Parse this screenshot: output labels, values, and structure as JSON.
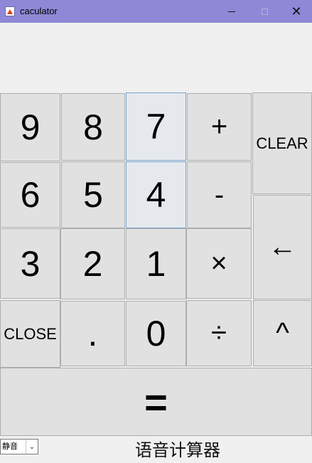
{
  "window": {
    "title": "caculator",
    "minimize_icon": "minimize-icon",
    "maximize_icon": "maximize-icon",
    "close_icon": "close-icon",
    "close_glyph": "✕"
  },
  "display": {
    "value": ""
  },
  "keys": {
    "k9": "9",
    "k8": "8",
    "k7": "7",
    "plus": "+",
    "clear": "CLEAR",
    "k6": "6",
    "k5": "5",
    "k4": "4",
    "minus": "-",
    "k3": "3",
    "k2": "2",
    "k1": "1",
    "multiply": "×",
    "backspace": "←",
    "close": "CLOSE",
    "dot": ".",
    "k0": "0",
    "divide": "÷",
    "power": "^",
    "equals": "="
  },
  "bottom": {
    "mode_selected": "静音",
    "label": "语音计算器"
  },
  "colors": {
    "titlebar": "#8e88d6",
    "button_face": "#e1e1e1",
    "focused_button": "#e5e9ee",
    "focus_border": "#7aa2cc"
  }
}
